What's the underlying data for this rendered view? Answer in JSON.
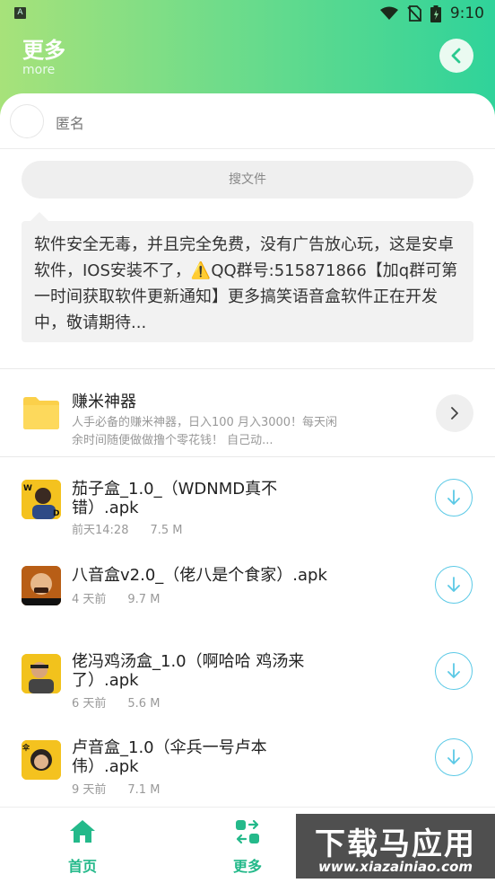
{
  "status_bar": {
    "time": "9:10",
    "app_badge": "A"
  },
  "header": {
    "title": "更多",
    "subtitle": "more",
    "back_icon": "chevron-left-icon"
  },
  "user": {
    "name": "匿名"
  },
  "search": {
    "label": "搜文件"
  },
  "notice": {
    "text_before": "软件安全无毒，并且完全免费，没有广告放心玩，这是安卓软件，IOS安装不了，",
    "warning_icon": "⚠️",
    "text_after": "QQ群号:515871866【加q群可第一时间获取软件更新通知】更多搞笑语音盒软件正在开发中，敬请期待..."
  },
  "folder": {
    "title": "赚米神器",
    "description": "人手必备的赚米神器，日入100 月入3000！每天闲余时间随便做做撸个零花钱！ 自己动..."
  },
  "files": [
    {
      "name": "茄子盒_1.0_（WDNMD真不错）.apk",
      "time": "前天14:28",
      "size": "7.5 M"
    },
    {
      "name": "八音盒v2.0_（佬八是个食家）.apk",
      "time": "4 天前",
      "size": "9.7 M"
    },
    {
      "name": "佬冯鸡汤盒_1.0（啊哈哈 鸡汤来了）.apk",
      "time": "6 天前",
      "size": "5.6 M"
    },
    {
      "name": "卢音盒_1.0（伞兵一号卢本伟）.apk",
      "time": "9 天前",
      "size": "7.1 M"
    }
  ],
  "nav": {
    "home": "首页",
    "more": "更多"
  },
  "watermark": {
    "title": "下载马应用",
    "url": "www.xiazainiao.com"
  },
  "colors": {
    "accent": "#24b98a",
    "download_ring": "#5bc9e6",
    "folder": "#fbd04a"
  }
}
